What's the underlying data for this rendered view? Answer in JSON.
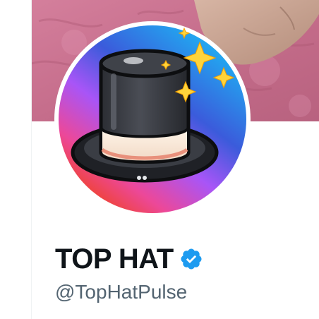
{
  "profile": {
    "display_name": "TOP HAT",
    "handle": "@TopHatPulse",
    "verified": true,
    "verified_icon": "verified-badge-icon"
  },
  "avatar": {
    "icon": "top-hat-icon",
    "ring_colors": [
      "#2563eb",
      "#7c3aed",
      "#db2777",
      "#ef4444"
    ]
  },
  "banner": {
    "icon": "banner-image",
    "background_color": "#c9738f"
  },
  "colors": {
    "accent": "#1d9bf0",
    "name_text": "#0f1419",
    "handle_text": "#536471"
  }
}
